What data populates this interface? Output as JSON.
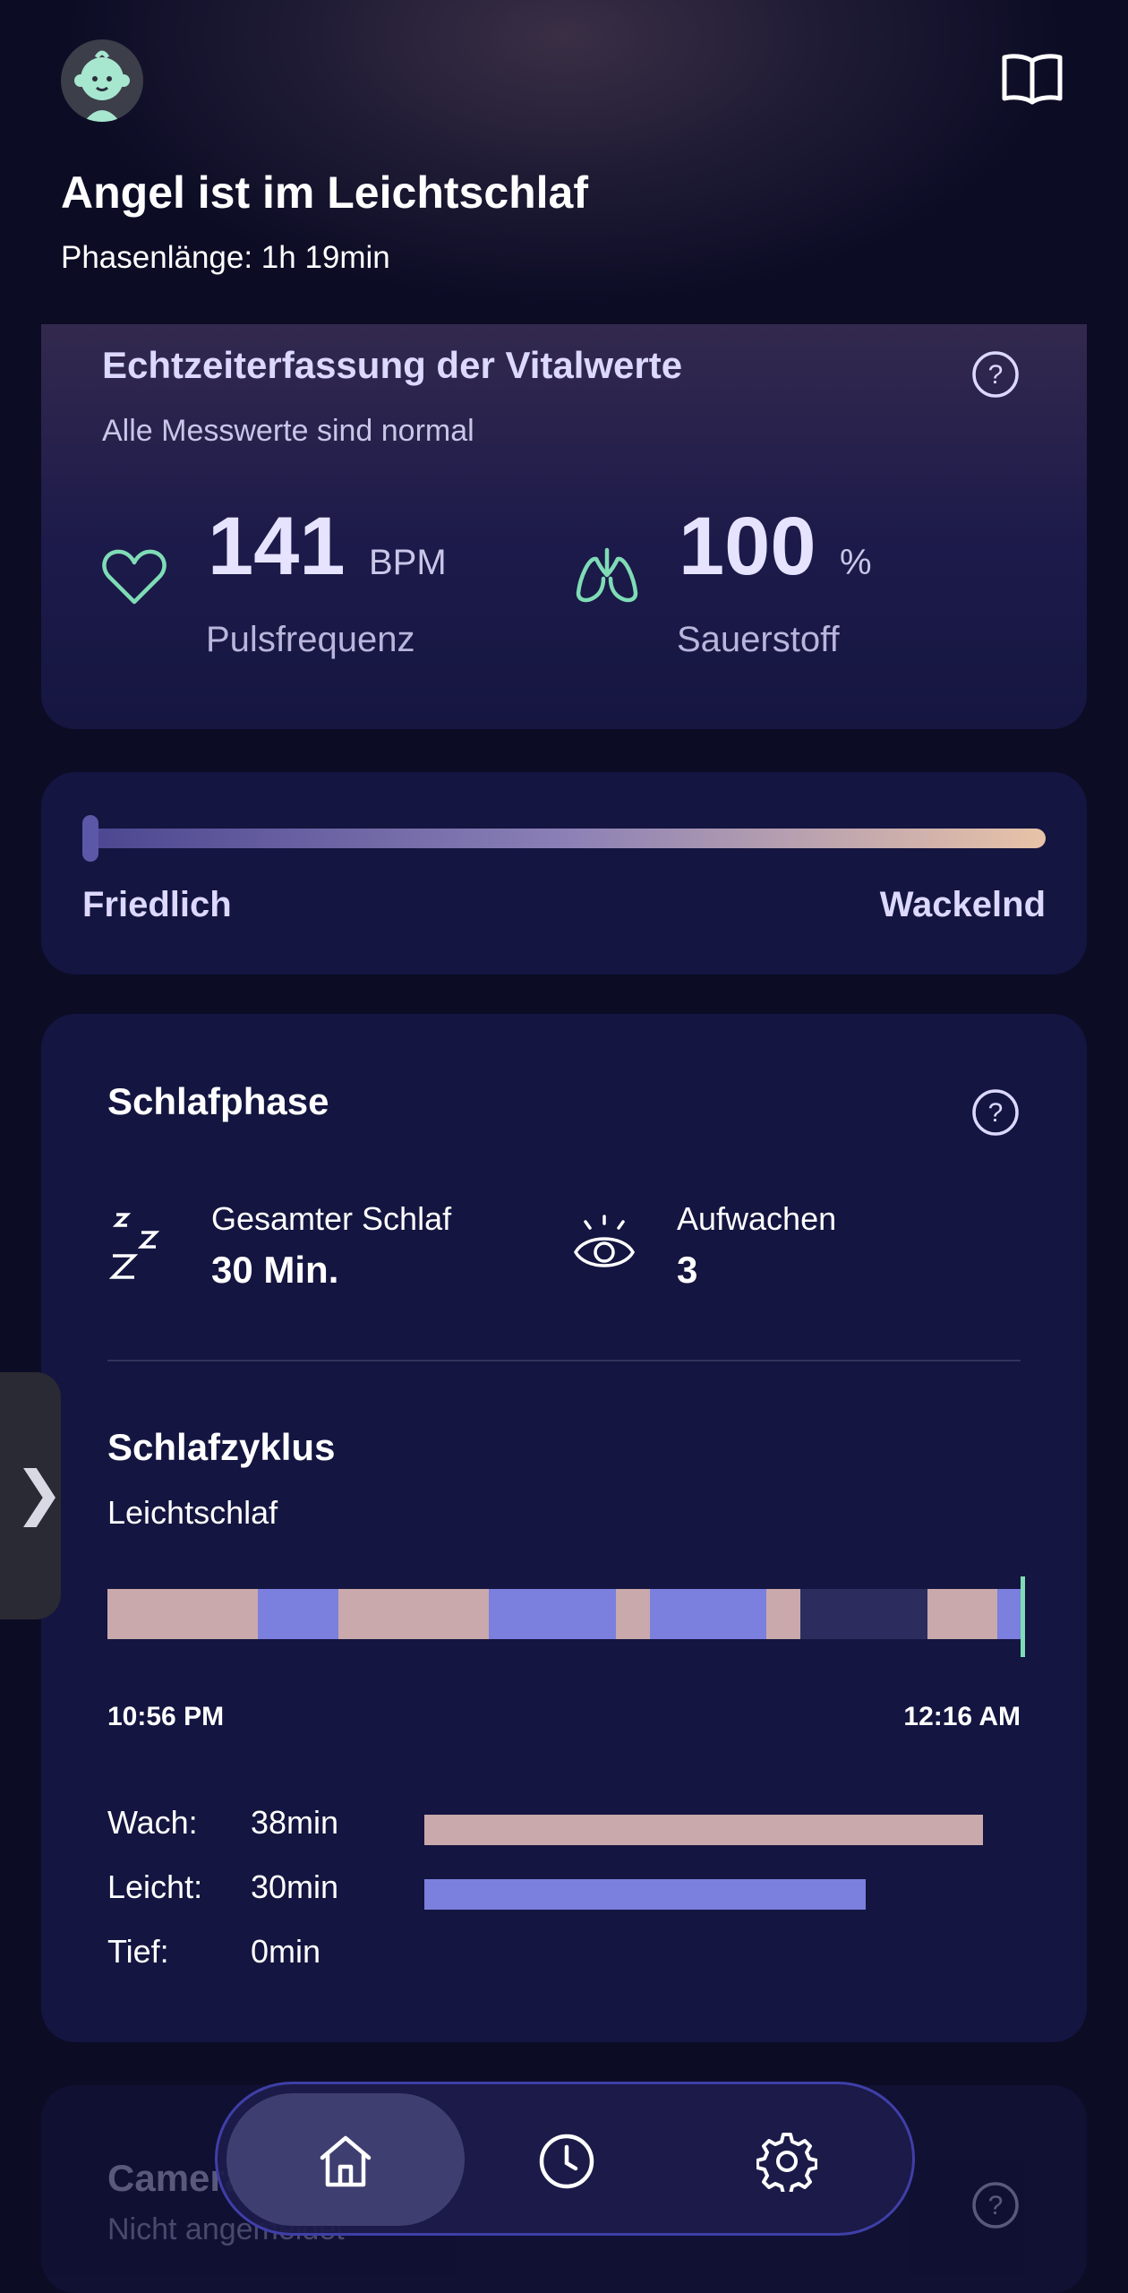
{
  "header": {
    "title": "Angel ist im Leichtschlaf",
    "subtitle": "Phasenlänge: 1h 19min",
    "avatar_icon": "baby-face-icon",
    "guide_icon": "open-book-icon"
  },
  "vitals": {
    "title": "Echtzeiterfassung der Vitalwerte",
    "subtitle": "Alle Messwerte sind normal",
    "pulse": {
      "value": "141",
      "unit": "BPM",
      "label": "Pulsfrequenz",
      "icon": "heart-icon"
    },
    "oxygen": {
      "value": "100",
      "unit": "%",
      "label": "Sauerstoff",
      "icon": "lungs-icon"
    }
  },
  "movement": {
    "left_label": "Friedlich",
    "right_label": "Wackelnd",
    "level": 0.0
  },
  "sleep_phase": {
    "title": "Schlafphase",
    "total_sleep": {
      "label": "Gesamter Schlaf",
      "value": "30 Min.",
      "icon": "zzz-icon"
    },
    "wakeups": {
      "label": "Aufwachen",
      "value": "3",
      "icon": "eye-icon"
    },
    "cycle": {
      "title": "Schlafzyklus",
      "subtitle": "Leichtschlaf",
      "start_time": "10:56 PM",
      "end_time": "12:16 AM",
      "segments": [
        "wach",
        "leicht",
        "wach",
        "leicht",
        "wach",
        "leicht",
        "wach",
        "tief",
        "wach",
        "leicht"
      ]
    },
    "legend": [
      {
        "name": "Wach:",
        "value": "38min",
        "minutes": 38
      },
      {
        "name": "Leicht:",
        "value": "30min",
        "minutes": 30
      },
      {
        "name": "Tief:",
        "value": "0min",
        "minutes": 0
      }
    ]
  },
  "camera": {
    "title": "Camera",
    "subtitle": "Nicht angemeldet"
  },
  "colors": {
    "wach": "#c9a9ab",
    "leicht": "#7b7fde",
    "tief": "#2c2d5e",
    "accent": "#7fdcb6"
  },
  "nav": {
    "items": [
      {
        "icon": "home-icon",
        "active": true
      },
      {
        "icon": "clock-icon",
        "active": false
      },
      {
        "icon": "gear-icon",
        "active": false
      }
    ]
  },
  "side_tab": {
    "glyph": "❯"
  }
}
